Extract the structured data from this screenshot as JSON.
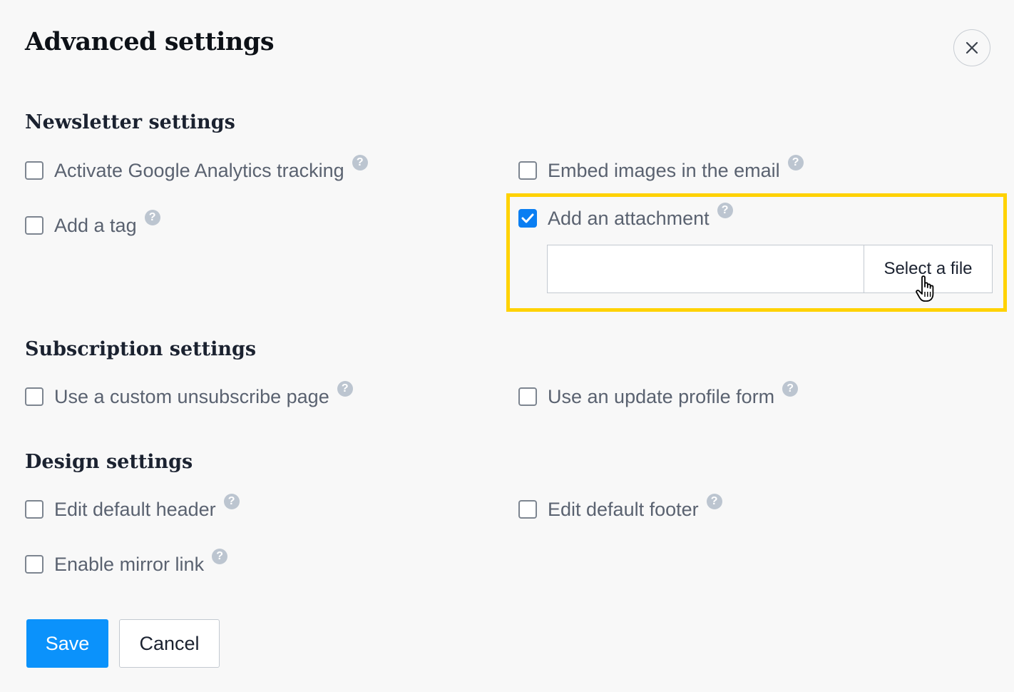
{
  "dialog": {
    "title": "Advanced settings",
    "close_icon": "close-icon"
  },
  "sections": {
    "newsletter": {
      "title": "Newsletter settings",
      "options": {
        "google_analytics": {
          "label": "Activate Google Analytics tracking",
          "checked": false
        },
        "embed_images": {
          "label": "Embed images in the email",
          "checked": false
        },
        "add_tag": {
          "label": "Add a tag",
          "checked": false
        },
        "add_attachment": {
          "label": "Add an attachment",
          "checked": true
        }
      },
      "attachment": {
        "file_value": "",
        "select_button_label": "Select a file"
      }
    },
    "subscription": {
      "title": "Subscription settings",
      "options": {
        "custom_unsubscribe": {
          "label": "Use a custom unsubscribe page",
          "checked": false
        },
        "update_profile": {
          "label": "Use an update profile form",
          "checked": false
        }
      }
    },
    "design": {
      "title": "Design settings",
      "options": {
        "default_header": {
          "label": "Edit default header",
          "checked": false
        },
        "default_footer": {
          "label": "Edit default footer",
          "checked": false
        },
        "mirror_link": {
          "label": "Enable mirror link",
          "checked": false
        }
      }
    }
  },
  "help_glyph": "?",
  "actions": {
    "save_label": "Save",
    "cancel_label": "Cancel"
  },
  "colors": {
    "accent": "#0b92fb",
    "checkbox_checked": "#0a7ef2",
    "highlight": "#ffd200",
    "help_icon": "#bcc5d0"
  }
}
